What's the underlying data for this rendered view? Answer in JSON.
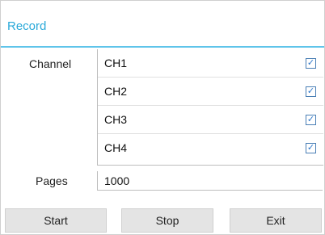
{
  "dialog": {
    "title": "Record",
    "accent_color": "#2aa9d9"
  },
  "channel": {
    "label": "Channel",
    "items": [
      {
        "name": "CH1",
        "checked": true,
        "check_icon": "checkbox-checked-icon"
      },
      {
        "name": "CH2",
        "checked": true,
        "check_icon": "checkbox-checked-icon"
      },
      {
        "name": "CH3",
        "checked": true,
        "check_icon": "checkbox-checked-icon"
      },
      {
        "name": "CH4",
        "checked": true,
        "check_icon": "checkbox-checked-icon"
      }
    ]
  },
  "pages": {
    "label": "Pages",
    "value": "1000"
  },
  "buttons": {
    "start": "Start",
    "stop": "Stop",
    "exit": "Exit"
  }
}
